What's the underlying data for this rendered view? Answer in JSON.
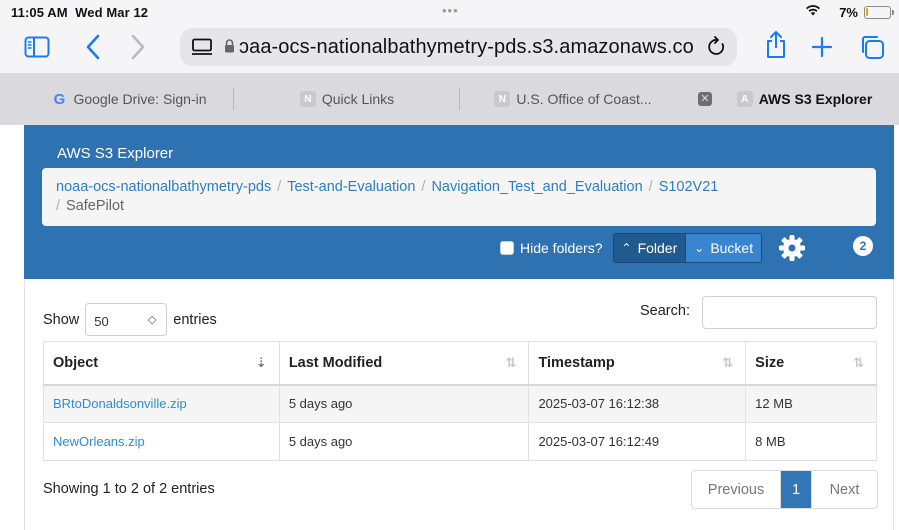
{
  "status": {
    "time": "11:05 AM",
    "date": "Wed Mar 12",
    "battery": "7%"
  },
  "browser": {
    "url": "ɔaa-ocs-nationalbathymetry-pds.s3.amazonaws.com",
    "tabs": [
      {
        "label": "Google Drive: Sign-in",
        "favicon": "G"
      },
      {
        "label": "Quick Links",
        "favicon": "N"
      },
      {
        "label": "U.S. Office of Coast...",
        "favicon": "N"
      },
      {
        "label": "AWS S3 Explorer",
        "favicon": "A",
        "active": true
      }
    ],
    "accent": "#1a7cf5"
  },
  "app": {
    "title": "AWS S3 Explorer",
    "header_color": "#2f72b1",
    "breadcrumb": [
      "noaa-ocs-nationalbathymetry-pds",
      "Test-and-Evaluation",
      "Navigation_Test_and_Evaluation",
      "S102V21",
      "SafePilot"
    ],
    "hide_folders_label": "Hide folders?",
    "folder_label": "Folder",
    "bucket_label": "Bucket",
    "badge_count": "2"
  },
  "table": {
    "show_label": "Show",
    "entries_label": "entries",
    "page_length": "50",
    "search_label": "Search:",
    "columns": [
      "Object",
      "Last Modified",
      "Timestamp",
      "Size"
    ],
    "rows": [
      {
        "object": "BRtoDonaldsonville.zip",
        "modified": "5 days ago",
        "timestamp": "2025-03-07 16:12:38",
        "size": "12 MB"
      },
      {
        "object": "NewOrleans.zip",
        "modified": "5 days ago",
        "timestamp": "2025-03-07 16:12:49",
        "size": "8 MB"
      }
    ],
    "info": "Showing 1 to 2 of 2 entries",
    "pagination": {
      "previous": "Previous",
      "current": "1",
      "next": "Next"
    }
  }
}
